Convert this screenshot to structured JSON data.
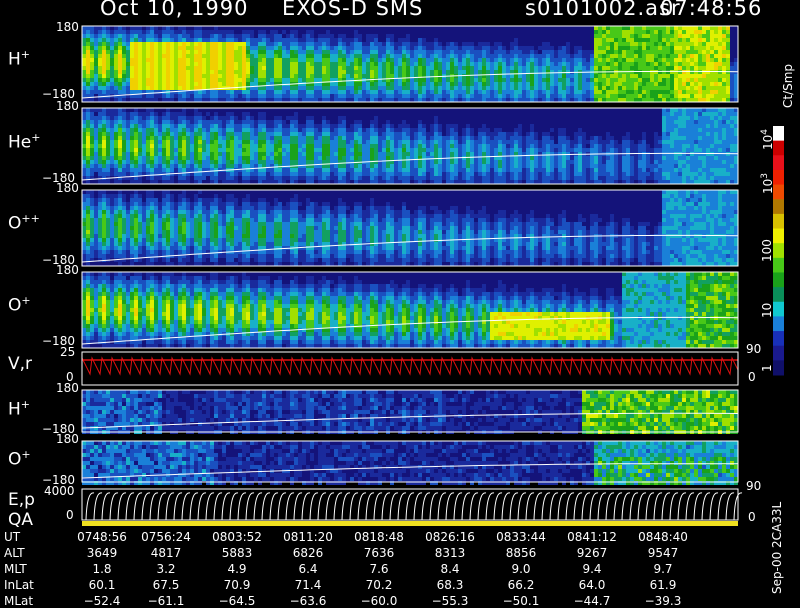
{
  "header": {
    "date": "Oct 10, 1990",
    "mission": "EXOS-D SMS",
    "file": "s0101002.asr",
    "time": "07:48:56"
  },
  "panels": [
    {
      "label": "H",
      "sup": "+",
      "ymax": "180",
      "ymin": "−180"
    },
    {
      "label": "He",
      "sup": "+",
      "ymax": "180",
      "ymin": "−180"
    },
    {
      "label": "O",
      "sup": "++",
      "ymax": "180",
      "ymin": "−180"
    },
    {
      "label": "O",
      "sup": "+",
      "ymax": "180",
      "ymin": "−180"
    },
    {
      "label": "H",
      "sup": "+",
      "ymax": "180",
      "ymin": "−180"
    },
    {
      "label": "O",
      "sup": "+",
      "ymax": "180",
      "ymin": "−180"
    }
  ],
  "vr_panel": {
    "label": "V,r",
    "ymax": "25",
    "ymin": "0",
    "right_top": "90",
    "right_bottom": "0"
  },
  "ep_panel": {
    "label1": "E,p",
    "label2": "QA",
    "ymax": "4000",
    "ymin": "0",
    "right_top": "90",
    "right_bottom": "0"
  },
  "colorbar": {
    "unit": "Ct/Smp",
    "tick_labels": [
      "10",
      "10",
      "100",
      "10",
      "1"
    ],
    "tick_sups": [
      "4",
      "3",
      "",
      "",
      ""
    ],
    "colors": [
      "#ffffff",
      "#cc0000",
      "#e8101a",
      "#f02000",
      "#ee4a00",
      "#b07800",
      "#d8c000",
      "#f0f000",
      "#a0e000",
      "#48c818",
      "#1aa21a",
      "#0a8f5a",
      "#10c8d0",
      "#1a7fd8",
      "#1830b8",
      "#1a1a8f",
      "#10106a"
    ]
  },
  "footer_note": "Sep-00 2CA33L",
  "table": {
    "rows": [
      {
        "label": "UT",
        "values": [
          "0748:56",
          "0756:24",
          "0803:52",
          "0811:20",
          "0818:48",
          "0826:16",
          "0833:44",
          "0841:12",
          "0848:40"
        ]
      },
      {
        "label": "ALT",
        "values": [
          "3649",
          "4817",
          "5883",
          "6826",
          "7636",
          "8313",
          "8856",
          "9267",
          "9547"
        ]
      },
      {
        "label": "MLT",
        "values": [
          "1.8",
          "3.2",
          "4.9",
          "6.4",
          "7.6",
          "8.4",
          "9.0",
          "9.4",
          "9.7"
        ]
      },
      {
        "label": "InLat",
        "values": [
          "60.1",
          "67.5",
          "70.9",
          "71.4",
          "70.2",
          "68.3",
          "66.2",
          "64.0",
          "61.9"
        ]
      },
      {
        "label": "MLat",
        "values": [
          "−52.4",
          "−61.1",
          "−64.5",
          "−63.6",
          "−60.0",
          "−55.3",
          "−50.1",
          "−44.7",
          "−39.3"
        ]
      }
    ]
  },
  "chart_data": {
    "type": "heatmap",
    "title": "Oct 10, 1990   EXOS-D SMS",
    "x_time_ticks": [
      "0748:56",
      "0756:24",
      "0803:52",
      "0811:20",
      "0818:48",
      "0826:16",
      "0833:44",
      "0841:12",
      "0848:40"
    ],
    "x_range": [
      "0748:56",
      "0848:40"
    ],
    "panels": [
      {
        "name": "H+",
        "y_range": [
          -180,
          180
        ]
      },
      {
        "name": "He+",
        "y_range": [
          -180,
          180
        ]
      },
      {
        "name": "O++",
        "y_range": [
          -180,
          180
        ]
      },
      {
        "name": "O+",
        "y_range": [
          -180,
          180
        ]
      },
      {
        "name": "V,r",
        "y_range": [
          0,
          25
        ],
        "right_range": [
          0,
          90
        ]
      },
      {
        "name": "H+",
        "y_range": [
          -180,
          180
        ]
      },
      {
        "name": "O+",
        "y_range": [
          -180,
          180
        ]
      },
      {
        "name": "E,p",
        "y_range": [
          0,
          4000
        ],
        "right_range": [
          0,
          90
        ]
      }
    ],
    "colorbar_scale": "log",
    "colorbar_range": [
      1,
      10000
    ],
    "colorbar_unit": "Ct/Smp"
  }
}
